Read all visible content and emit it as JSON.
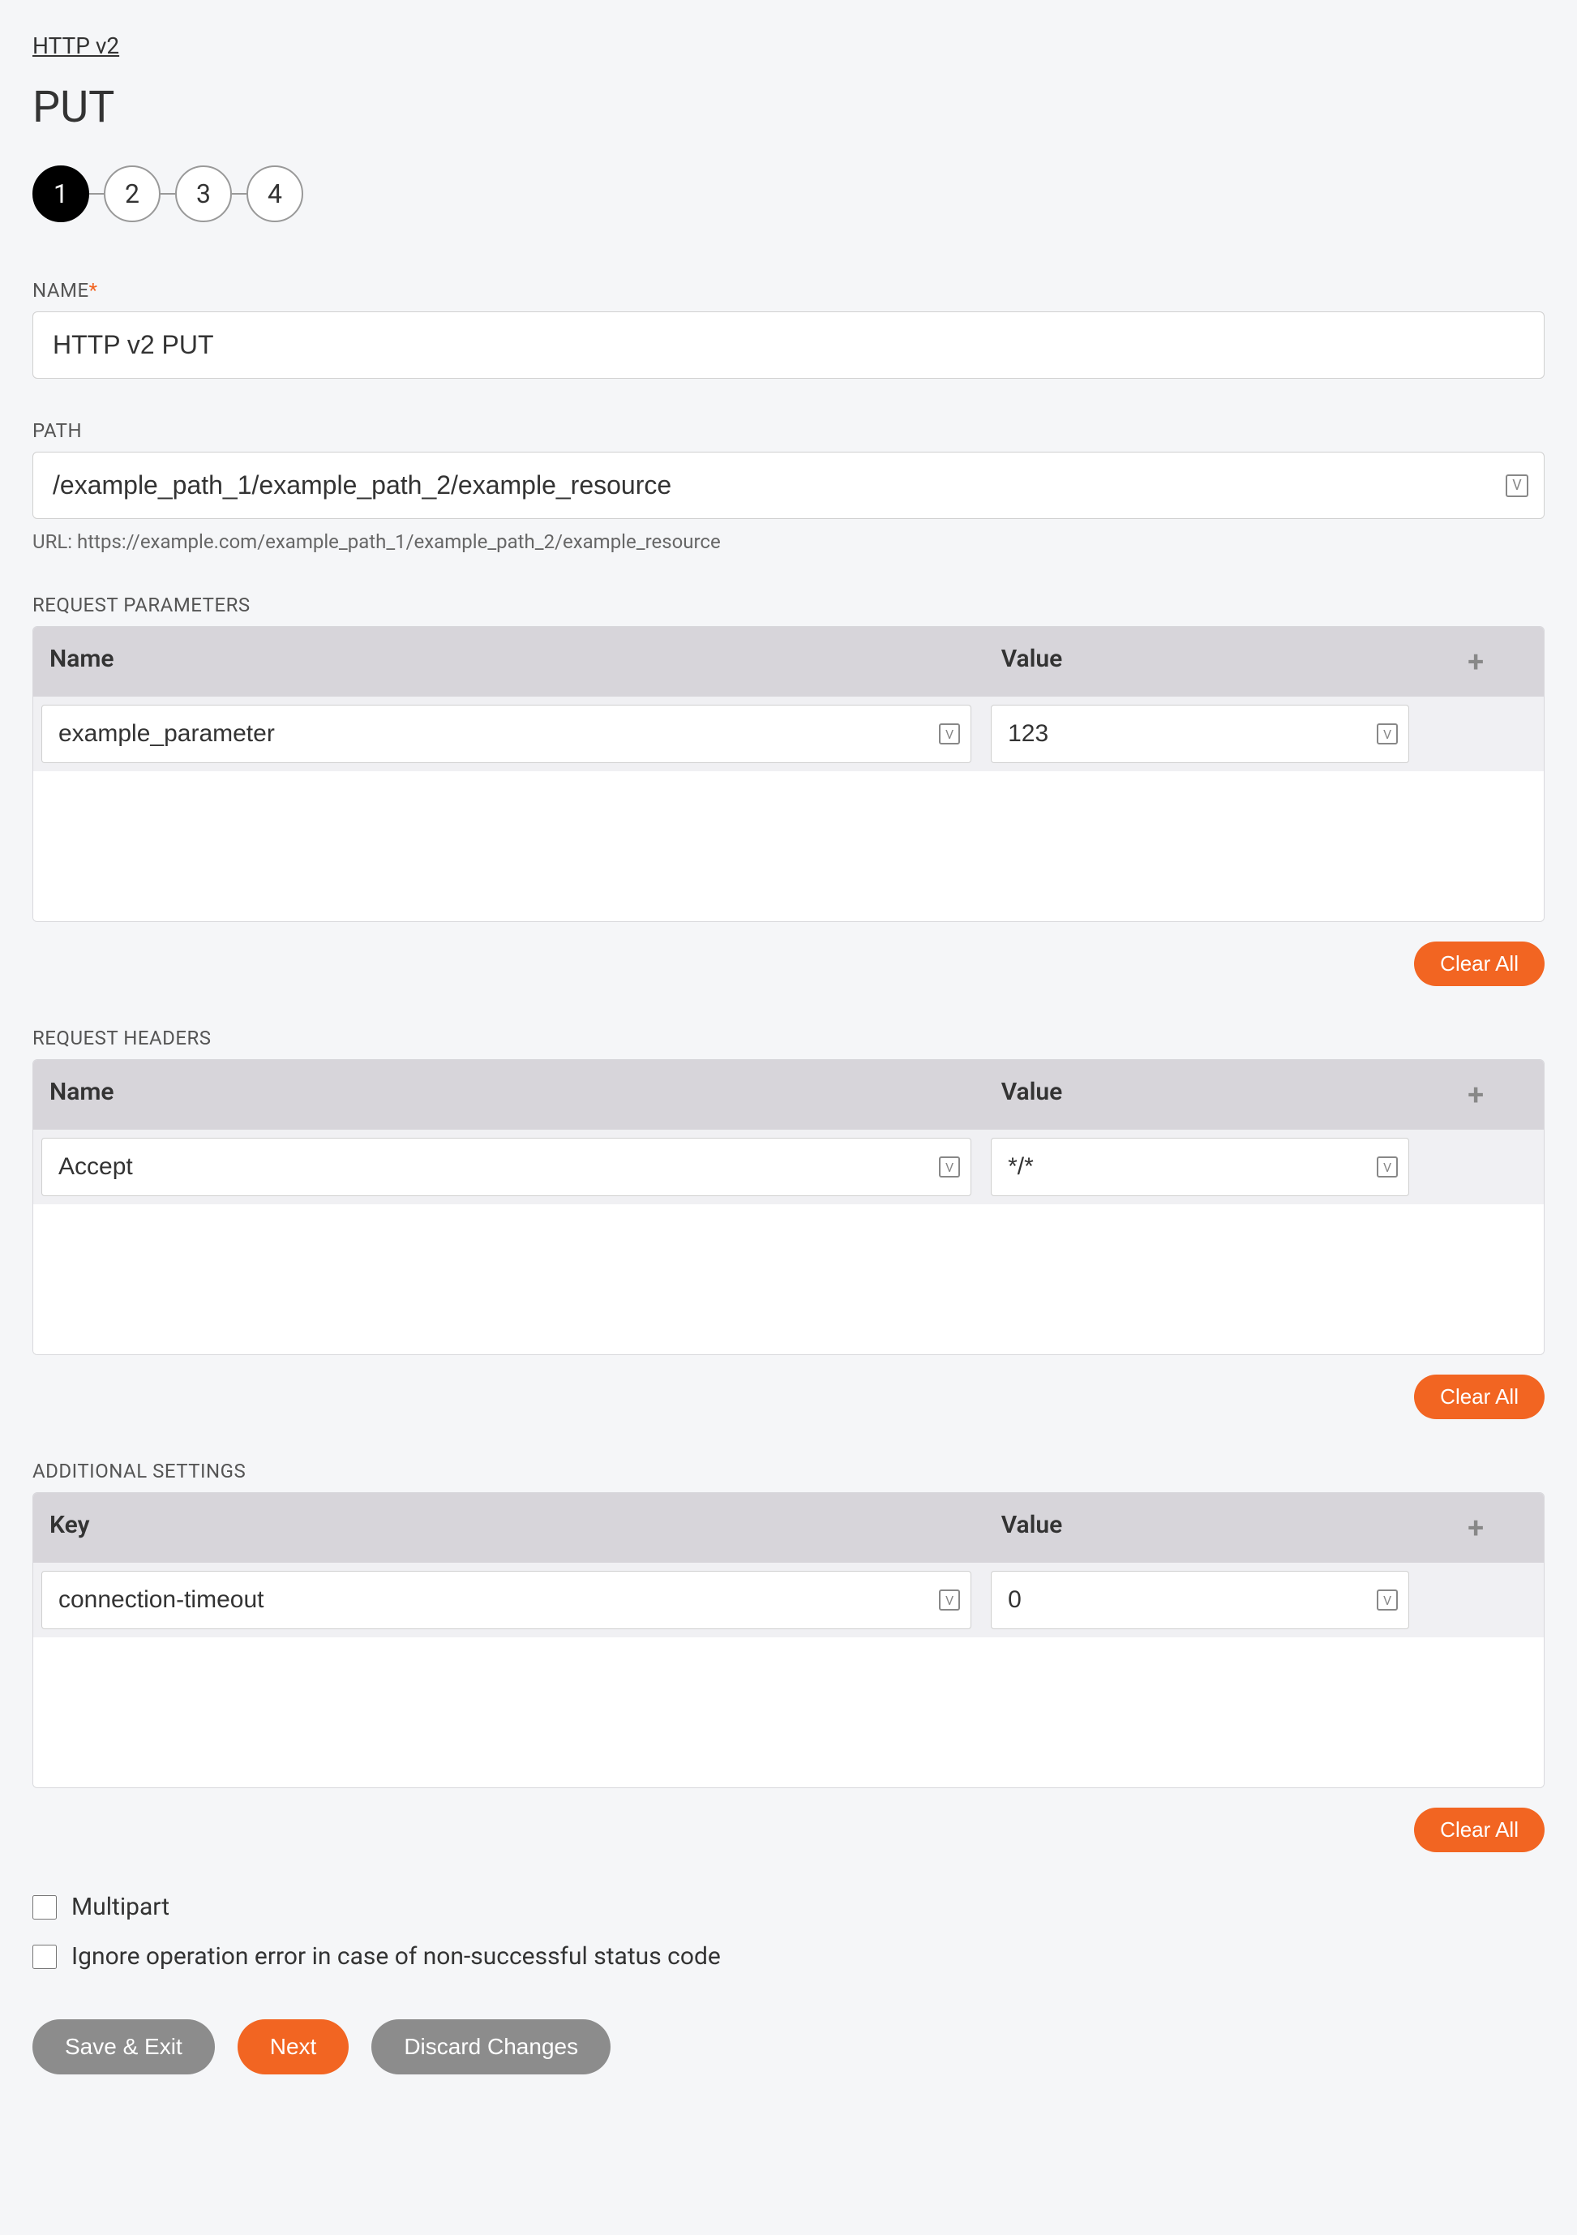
{
  "breadcrumb": "HTTP v2",
  "title": "PUT",
  "steps": [
    "1",
    "2",
    "3",
    "4"
  ],
  "active_step": 0,
  "name_field": {
    "label": "NAME",
    "required": "*",
    "value": "HTTP v2 PUT"
  },
  "path_field": {
    "label": "PATH",
    "value": "/example_path_1/example_path_2/example_resource",
    "hint_prefix": "URL: ",
    "hint_url": "https://example.com/example_path_1/example_path_2/example_resource"
  },
  "params_section": {
    "label": "REQUEST PARAMETERS",
    "col_name": "Name",
    "col_value": "Value",
    "rows": [
      {
        "name": "example_parameter",
        "value": "123"
      }
    ],
    "clear": "Clear All"
  },
  "headers_section": {
    "label": "REQUEST HEADERS",
    "col_name": "Name",
    "col_value": "Value",
    "rows": [
      {
        "name": "Accept",
        "value": "*/*"
      }
    ],
    "clear": "Clear All"
  },
  "additional_section": {
    "label": "ADDITIONAL SETTINGS",
    "col_name": "Key",
    "col_value": "Value",
    "rows": [
      {
        "name": "connection-timeout",
        "value": "0"
      }
    ],
    "clear": "Clear All"
  },
  "checks": {
    "multipart": "Multipart",
    "ignore_error": "Ignore operation error in case of non-successful status code"
  },
  "footer": {
    "save_exit": "Save & Exit",
    "next": "Next",
    "discard": "Discard Changes"
  },
  "icons": {
    "var": "V",
    "plus": "+"
  }
}
